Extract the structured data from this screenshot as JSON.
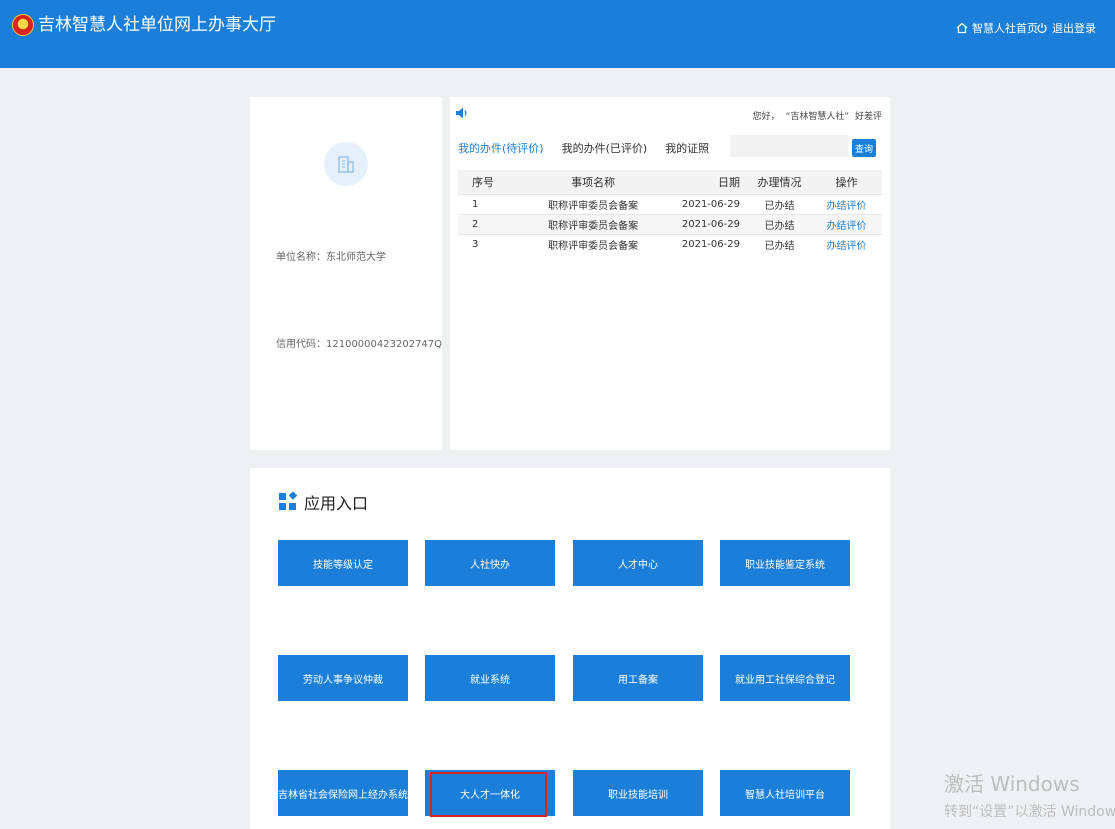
{
  "header": {
    "title": "吉林智慧人社单位网上办事大厅",
    "home_link": "智慧人社首页",
    "logout_link": "退出登录"
  },
  "unit": {
    "name_line": "单位名称：东北师范大学",
    "code_line": "信用代码：12100000423202747Q"
  },
  "tasks": {
    "greeting_prefix": "您好，",
    "greeting_name": "“吉林智慧人社”",
    "greeting_suffix": "好差评",
    "tabs": [
      "我的办件(待评价)",
      "我的办件(已评价)",
      "我的证照"
    ],
    "search_placeholder": "",
    "search_label": "查询",
    "columns": [
      "序号",
      "事项名称",
      "日期",
      "办理情况",
      "操作"
    ],
    "rows": [
      {
        "idx": "1",
        "name": "职称评审委员会备案",
        "date": "2021-06-29",
        "status": "已办结",
        "op": "办结评价"
      },
      {
        "idx": "2",
        "name": "职称评审委员会备案",
        "date": "2021-06-29",
        "status": "已办结",
        "op": "办结评价"
      },
      {
        "idx": "3",
        "name": "职称评审委员会备案",
        "date": "2021-06-29",
        "status": "已办结",
        "op": "办结评价"
      }
    ]
  },
  "apps": {
    "title": "应用入口",
    "buttons": [
      "技能等级认定",
      "人社快办",
      "人才中心",
      "职业技能鉴定系统",
      "劳动人事争议仲裁",
      "就业系统",
      "用工备案",
      "就业用工社保综合登记",
      "吉林省社会保险网上经办系统",
      "大人才一体化",
      "职业技能培训",
      "智慧人社培训平台"
    ]
  },
  "watermark": {
    "line1": "激活 Windows",
    "line2": "转到“设置”以激活 Windows。"
  },
  "colors": {
    "primary": "#1b7fd9",
    "highlight": "#d8231f",
    "background": "#eef0f3"
  }
}
